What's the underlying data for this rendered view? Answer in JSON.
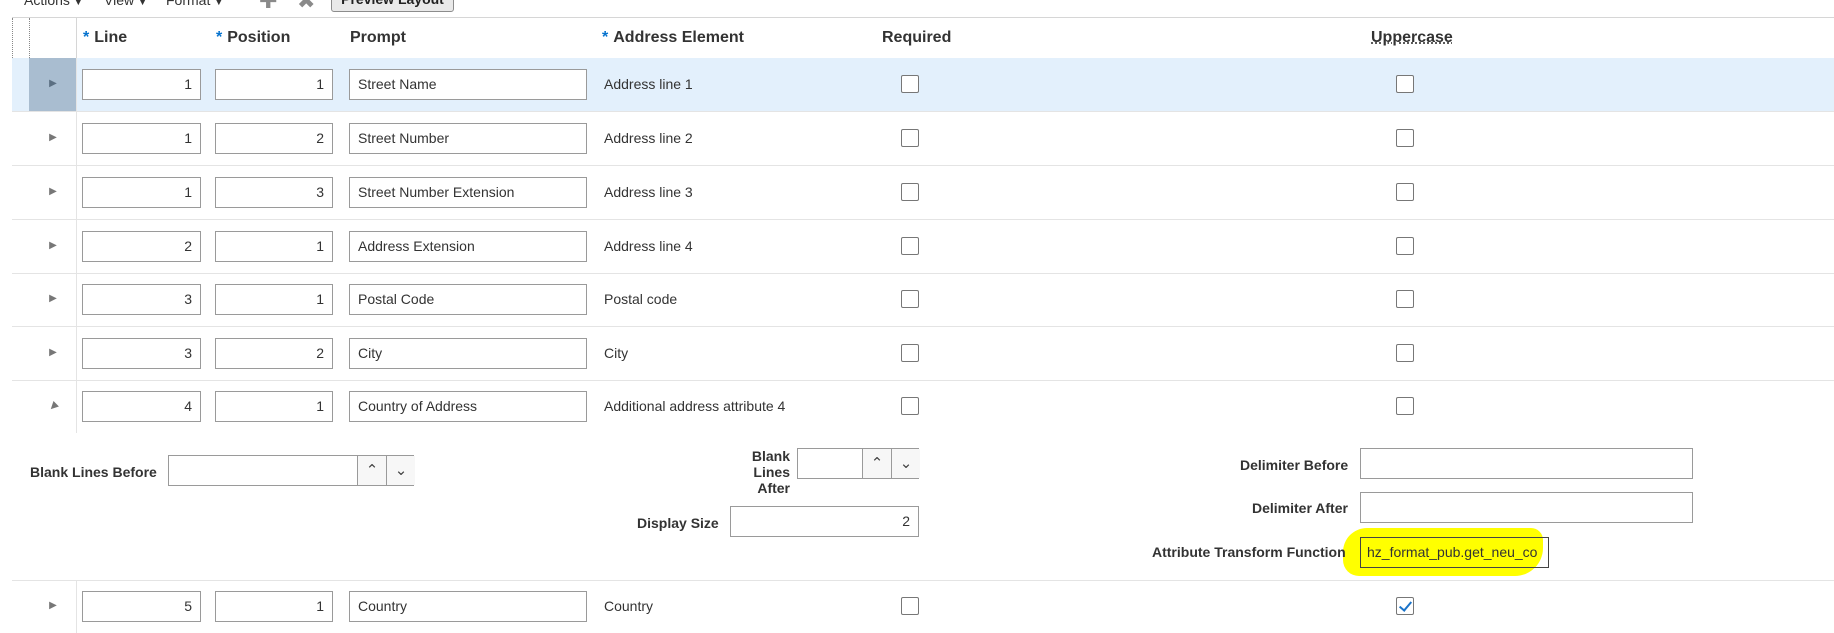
{
  "toolbar": {
    "actions": "Actions",
    "view": "View",
    "format": "Format",
    "preview_layout": "Preview Layout",
    "add_icon": "plus-icon",
    "delete_icon": "x-icon"
  },
  "columns": {
    "line": "Line",
    "position": "Position",
    "prompt": "Prompt",
    "address_element": "Address Element",
    "required": "Required",
    "uppercase": "Uppercase",
    "required_marker": "*"
  },
  "rows": [
    {
      "line": "1",
      "position": "1",
      "prompt": "Street Name",
      "address_element": "Address line 1",
      "required": false,
      "uppercase": false,
      "expanded": false,
      "selected": true
    },
    {
      "line": "1",
      "position": "2",
      "prompt": "Street Number",
      "address_element": "Address line 2",
      "required": false,
      "uppercase": false,
      "expanded": false,
      "selected": false
    },
    {
      "line": "1",
      "position": "3",
      "prompt": "Street Number Extension",
      "address_element": "Address line 3",
      "required": false,
      "uppercase": false,
      "expanded": false,
      "selected": false
    },
    {
      "line": "2",
      "position": "1",
      "prompt": "Address Extension",
      "address_element": "Address line 4",
      "required": false,
      "uppercase": false,
      "expanded": false,
      "selected": false
    },
    {
      "line": "3",
      "position": "1",
      "prompt": "Postal Code",
      "address_element": "Postal code",
      "required": false,
      "uppercase": false,
      "expanded": false,
      "selected": false
    },
    {
      "line": "3",
      "position": "2",
      "prompt": "City",
      "address_element": "City",
      "required": false,
      "uppercase": false,
      "expanded": false,
      "selected": false
    },
    {
      "line": "4",
      "position": "1",
      "prompt": "Country of Address",
      "address_element": "Additional address attribute 4",
      "required": false,
      "uppercase": false,
      "expanded": true,
      "selected": false
    },
    {
      "line": "5",
      "position": "1",
      "prompt": "Country",
      "address_element": "Country",
      "required": false,
      "uppercase": true,
      "expanded": false,
      "selected": false
    }
  ],
  "detail": {
    "blank_lines_before_label": "Blank Lines Before",
    "blank_lines_before_value": "",
    "blank_lines_after_label_1": "Blank",
    "blank_lines_after_label_2": "Lines",
    "blank_lines_after_label_3": "After",
    "blank_lines_after_value": "",
    "display_size_label": "Display Size",
    "display_size_value": "2",
    "delimiter_before_label": "Delimiter Before",
    "delimiter_before_value": "",
    "delimiter_after_label": "Delimiter After",
    "delimiter_after_value": "",
    "attribute_transform_label": "Attribute Transform Function",
    "attribute_transform_value": "hz_format_pub.get_neu_co",
    "spin_up_icon": "chevron-up-icon",
    "spin_down_icon": "chevron-down-icon"
  },
  "colors": {
    "required_marker": "#0572ce",
    "selected_row": "#e3f0fc",
    "highlight": "#ffff00",
    "checkmark": "#1a73c9"
  }
}
